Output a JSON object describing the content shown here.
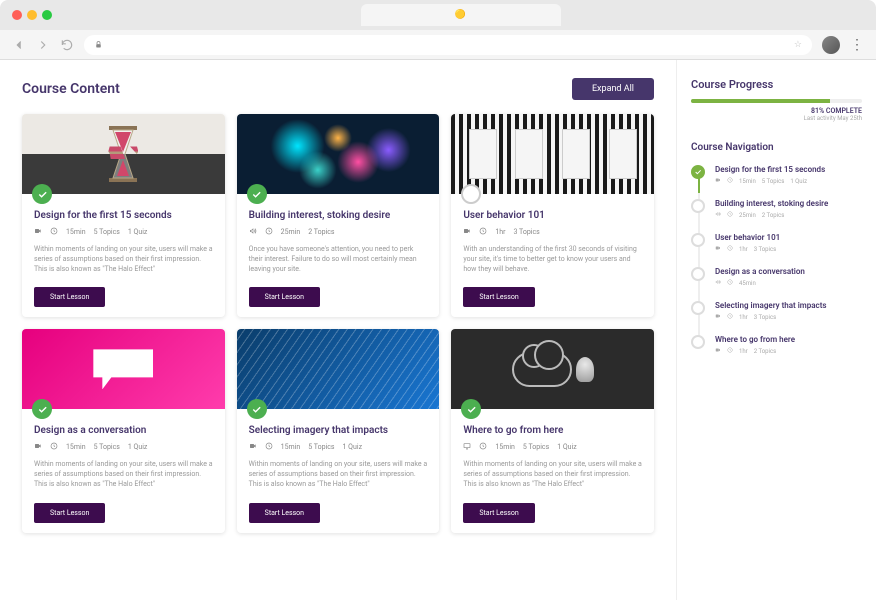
{
  "header": {
    "title": "Course Content",
    "expand_label": "Expand All"
  },
  "cards": [
    {
      "title": "Design for the first 15 seconds",
      "type": "video",
      "duration": "15min",
      "topics": "5 Topics",
      "quiz": "1 Quiz",
      "desc": "Within moments of landing on your site, users will make a series of assumptions based on their first impression. This is also known as \"The Halo Effect\"",
      "cta": "Start Lesson",
      "done": true,
      "thumb": "t0"
    },
    {
      "title": "Building interest, stoking desire",
      "type": "audio",
      "duration": "25min",
      "topics": "2 Topics",
      "quiz": "",
      "desc": "Once you have someone's attention, you need to perk their interest. Failure to do so will most certainly mean leaving your site.",
      "cta": "Start Lesson",
      "done": true,
      "thumb": "t1"
    },
    {
      "title": "User behavior 101",
      "type": "video",
      "duration": "1hr",
      "topics": "3 Topics",
      "quiz": "",
      "desc": "With an understanding of the first 30 seconds of visiting your site, it's time to better get to know your users and how they will behave.",
      "cta": "Start Lesson",
      "done": false,
      "thumb": "t2"
    },
    {
      "title": "Design as a conversation",
      "type": "video",
      "duration": "15min",
      "topics": "5 Topics",
      "quiz": "1 Quiz",
      "desc": "Within moments of landing on your site, users will make a series of assumptions based on their first impression. This is also known as \"The Halo Effect\"",
      "cta": "Start Lesson",
      "done": true,
      "thumb": "t3"
    },
    {
      "title": "Selecting imagery that impacts",
      "type": "video",
      "duration": "15min",
      "topics": "5 Topics",
      "quiz": "1 Quiz",
      "desc": "Within moments of landing on your site, users will make a series of assumptions based on their first impression. This is also known as \"The Halo Effect\"",
      "cta": "Start Lesson",
      "done": true,
      "thumb": "t4"
    },
    {
      "title": "Where to go from here",
      "type": "screen",
      "duration": "15min",
      "topics": "5 Topics",
      "quiz": "1 Quiz",
      "desc": "Within moments of landing on your site, users will make a series of assumptions based on their first impression. This is also known as \"The Halo Effect\"",
      "cta": "Start Lesson",
      "done": true,
      "thumb": "t5"
    }
  ],
  "progress": {
    "title": "Course Progress",
    "percent": 81,
    "percent_label": "81% COMPLETE",
    "sub": "Last activity May 25th"
  },
  "nav": {
    "title": "Course Navigation",
    "items": [
      {
        "title": "Design for the first 15 seconds",
        "type": "video",
        "duration": "15min",
        "topics": "5 Topics",
        "quiz": "1 Quiz",
        "done": true
      },
      {
        "title": "Building interest, stoking desire",
        "type": "audio",
        "duration": "25min",
        "topics": "2 Topics",
        "quiz": "",
        "done": false
      },
      {
        "title": "User behavior 101",
        "type": "video",
        "duration": "1hr",
        "topics": "3 Topics",
        "quiz": "",
        "done": false
      },
      {
        "title": "Design as a conversation",
        "type": "audio",
        "duration": "45min",
        "topics": "",
        "quiz": "",
        "done": false
      },
      {
        "title": "Selecting imagery that impacts",
        "type": "video",
        "duration": "1hr",
        "topics": "3 Topics",
        "quiz": "",
        "done": false
      },
      {
        "title": "Where to go from here",
        "type": "video",
        "duration": "1hr",
        "topics": "2 Topics",
        "quiz": "",
        "done": false
      }
    ]
  },
  "icons": {
    "video": "video-icon",
    "audio": "audio-icon",
    "screen": "screen-icon",
    "clock": "clock-icon"
  }
}
